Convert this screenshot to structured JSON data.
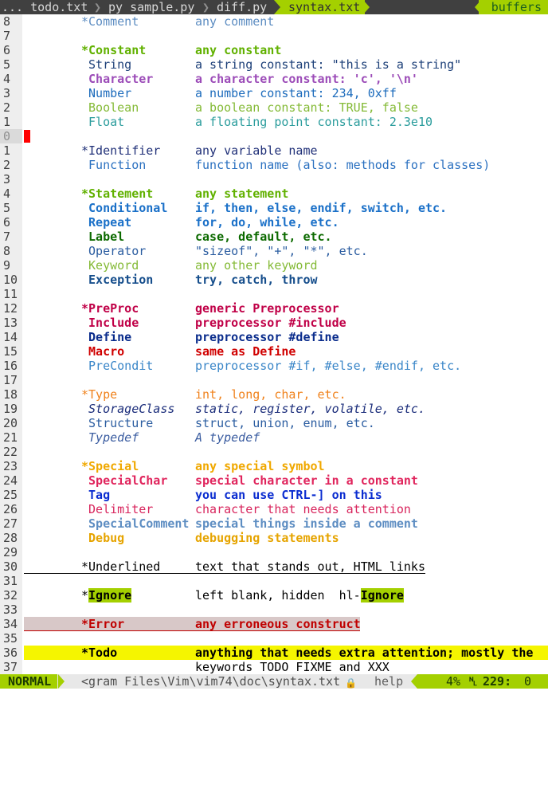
{
  "tabline": {
    "tabs": [
      "... todo.txt",
      "py sample.py",
      "diff.py",
      "syntax.txt"
    ],
    "buffers_label": "buffers"
  },
  "editor": {
    "lines": [
      {
        "n": "8",
        "g": "*Comment",
        "gc": "c-comment",
        "d": "any comment",
        "dc": "c-comment"
      },
      {
        "n": "7",
        "g": "",
        "d": ""
      },
      {
        "n": "6",
        "g": "*Constant",
        "gc": "c-constant",
        "d": "any constant",
        "dc": "c-constant"
      },
      {
        "n": "5",
        "g": " String",
        "gc": "c-string",
        "d": "a string constant: \"this is a string\"",
        "dc": "c-string"
      },
      {
        "n": "4",
        "g": " Character",
        "gc": "c-char",
        "d": "a character constant: 'c', '\\n'",
        "dc": "c-char"
      },
      {
        "n": "3",
        "g": " Number",
        "gc": "c-number",
        "d": "a number constant: 234, 0xff",
        "dc": "c-number"
      },
      {
        "n": "2",
        "g": " Boolean",
        "gc": "c-boolean",
        "d": "a boolean constant: TRUE, false",
        "dc": "c-boolean"
      },
      {
        "n": "1",
        "g": " Float",
        "gc": "c-float",
        "d": "a floating point constant: 2.3e10",
        "dc": "c-float"
      },
      {
        "n": "0",
        "g": "",
        "d": "",
        "cur": true
      },
      {
        "n": "1",
        "g": "*Identifier",
        "gc": "c-ident",
        "d": "any variable name",
        "dc": "c-ident"
      },
      {
        "n": "2",
        "g": " Function",
        "gc": "c-func",
        "d": "function name (also: methods for classes)",
        "dc": "c-func"
      },
      {
        "n": "3",
        "g": "",
        "d": ""
      },
      {
        "n": "4",
        "g": "*Statement",
        "gc": "c-stmt",
        "d": "any statement",
        "dc": "c-stmt"
      },
      {
        "n": "5",
        "g": " Conditional",
        "gc": "c-cond",
        "d": "if, then, else, endif, switch, etc.",
        "dc": "c-cond"
      },
      {
        "n": "6",
        "g": " Repeat",
        "gc": "c-repeat",
        "d": "for, do, while, etc.",
        "dc": "c-repeat"
      },
      {
        "n": "7",
        "g": " Label",
        "gc": "c-label",
        "d": "case, default, etc.",
        "dc": "c-label"
      },
      {
        "n": "8",
        "g": " Operator",
        "gc": "c-operator",
        "d": "\"sizeof\", \"+\", \"*\", etc.",
        "dc": "c-operator"
      },
      {
        "n": "9",
        "g": " Keyword",
        "gc": "c-keyword",
        "d": "any other keyword",
        "dc": "c-keyword"
      },
      {
        "n": "10",
        "g": " Exception",
        "gc": "c-exception",
        "d": "try, catch, throw",
        "dc": "c-exception"
      },
      {
        "n": "11",
        "g": "",
        "d": ""
      },
      {
        "n": "12",
        "g": "*PreProc",
        "gc": "c-preproc",
        "d": "generic Preprocessor",
        "dc": "c-preproc"
      },
      {
        "n": "13",
        "g": " Include",
        "gc": "c-include",
        "d": "preprocessor #include",
        "dc": "c-include"
      },
      {
        "n": "14",
        "g": " Define",
        "gc": "c-define",
        "d": "preprocessor #define",
        "dc": "c-define"
      },
      {
        "n": "15",
        "g": " Macro",
        "gc": "c-macro",
        "d": "same as Define",
        "dc": "c-macro"
      },
      {
        "n": "16",
        "g": " PreCondit",
        "gc": "c-precondit",
        "d": "preprocessor #if, #else, #endif, etc.",
        "dc": "c-precondit"
      },
      {
        "n": "17",
        "g": "",
        "d": ""
      },
      {
        "n": "18",
        "g": "*Type",
        "gc": "c-type",
        "d": "int, long, char, etc.",
        "dc": "c-type"
      },
      {
        "n": "19",
        "g": " StorageClass",
        "gc": "c-storage",
        "d": "static, register, volatile, etc.",
        "dc": "c-storage"
      },
      {
        "n": "20",
        "g": " Structure",
        "gc": "c-structure",
        "d": "struct, union, enum, etc.",
        "dc": "c-structure"
      },
      {
        "n": "21",
        "g": " Typedef",
        "gc": "c-typedef",
        "d": "A typedef",
        "dc": "c-typedef"
      },
      {
        "n": "22",
        "g": "",
        "d": ""
      },
      {
        "n": "23",
        "g": "*Special",
        "gc": "c-special",
        "d": "any special symbol",
        "dc": "c-special"
      },
      {
        "n": "24",
        "g": " SpecialChar",
        "gc": "c-specialchar",
        "d": "special character in a constant",
        "dc": "c-specialchar"
      },
      {
        "n": "25",
        "g": " Tag",
        "gc": "c-tag",
        "d": "you can use CTRL-] on this",
        "dc": "c-tag"
      },
      {
        "n": "26",
        "g": " Delimiter",
        "gc": "c-delim",
        "d": "character that needs attention",
        "dc": "c-delim"
      },
      {
        "n": "27",
        "g": " SpecialComment",
        "gc": "c-specialcomment",
        "d": "special things inside a comment",
        "dc": "c-specialcomment"
      },
      {
        "n": "28",
        "g": " Debug",
        "gc": "c-debug",
        "d": "debugging statements",
        "dc": "c-debug"
      },
      {
        "n": "29",
        "g": "",
        "d": ""
      },
      {
        "n": "30",
        "g": "*Underlined",
        "gc": "c-plain",
        "d": "text that stands out, HTML links",
        "dc": "c-plain",
        "kind": "underlined"
      },
      {
        "n": "31",
        "g": "",
        "d": ""
      },
      {
        "n": "32",
        "g": "*",
        "gc": "c-plain",
        "g2": "Ignore",
        "d": "left blank, hidden  hl-",
        "d2": "Ignore",
        "dc": "c-plain",
        "kind": "ignore"
      },
      {
        "n": "33",
        "g": "",
        "d": ""
      },
      {
        "n": "34",
        "g": "*Error",
        "gc": "c-error",
        "d": "any erroneous construct",
        "dc": "c-error",
        "kind": "error"
      },
      {
        "n": "35",
        "g": "",
        "d": ""
      },
      {
        "n": "36",
        "g": "*Todo",
        "gc": "c-todo",
        "d": "anything that needs extra attention; mostly the",
        "dc": "c-todo",
        "kind": "todo"
      },
      {
        "n": "37",
        "g": "",
        "d": "keywords TODO FIXME and XXX",
        "dc": "c-plain"
      }
    ]
  },
  "statusline": {
    "mode": "NORMAL",
    "filename": "<gram Files\\Vim\\vim74\\doc\\syntax.txt",
    "filetype": "help",
    "percent": "4%",
    "line": "229:",
    "column": "0"
  }
}
